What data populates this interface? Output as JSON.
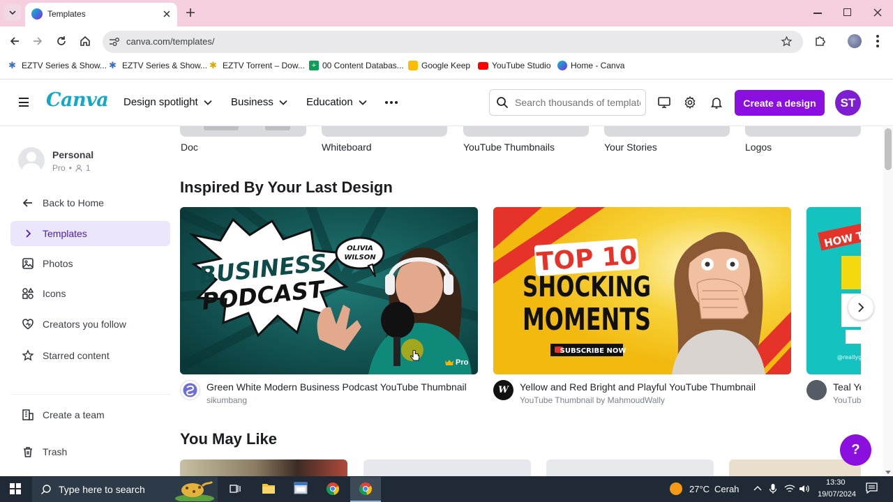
{
  "browser": {
    "tab_title": "Templates",
    "url": "canva.com/templates/",
    "bookmarks": [
      {
        "label": "EZTV Series & Show...",
        "icon": "eztv-icon"
      },
      {
        "label": "EZTV Series & Show...",
        "icon": "eztv-icon"
      },
      {
        "label": "EZTV Torrent – Dow...",
        "icon": "eztv-icon"
      },
      {
        "label": "00 Content Databas...",
        "icon": "sheets-icon"
      },
      {
        "label": "Google Keep",
        "icon": "keep-icon"
      },
      {
        "label": "YouTube Studio",
        "icon": "youtube-icon"
      },
      {
        "label": "Home - Canva",
        "icon": "canva-icon"
      }
    ]
  },
  "header": {
    "logo": "Canva",
    "nav": [
      "Design spotlight",
      "Business",
      "Education"
    ],
    "search_placeholder": "Search thousands of templates",
    "create_label": "Create a design",
    "avatar_initials": "ST",
    "brand_color": "#8b10e0"
  },
  "sidebar": {
    "profile_name": "Personal",
    "profile_plan": "Pro",
    "profile_members": "1",
    "items": [
      {
        "label": "Back to Home",
        "icon": "arrow-left-icon"
      },
      {
        "label": "Templates",
        "icon": "chevron-right-icon",
        "active": true
      },
      {
        "label": "Photos",
        "icon": "photo-icon"
      },
      {
        "label": "Icons",
        "icon": "shapes-icon"
      },
      {
        "label": "Creators you follow",
        "icon": "heart-icon"
      },
      {
        "label": "Starred content",
        "icon": "star-icon"
      }
    ],
    "create_team": "Create a team",
    "trash": "Trash"
  },
  "main": {
    "categories": [
      "Doc",
      "Whiteboard",
      "YouTube Thumbnails",
      "Your Stories",
      "Logos"
    ],
    "section_inspired": "Inspired By Your Last Design",
    "cards": [
      {
        "title": "Green White Modern Business Podcast YouTube Thumbnail",
        "author": "sikumbang",
        "badge": "Pro",
        "art_line1": "BUSINESS",
        "art_line2": "PODCAST",
        "art_bubble1": "OLIVIA",
        "art_bubble2": "WILSON"
      },
      {
        "title": "Yellow and Red Bright and Playful YouTube Thumbnail",
        "author": "YouTube Thumbnail by MahmoudWally",
        "art_line1": "TOP 10",
        "art_line2": "SHOCKING",
        "art_line3": "MOMENTS",
        "art_button": "SUBSCRIBE NOW"
      },
      {
        "title": "Teal Ye",
        "author": "YouTub",
        "art_line1": "HOW T",
        "art_handle": "@reallyg"
      }
    ],
    "section_maylike": "You May Like",
    "help_label": "?"
  },
  "taskbar": {
    "search_placeholder": "Type here to search",
    "weather_temp": "27°C",
    "weather_desc": "Cerah",
    "time": "13:30",
    "date": "19/07/2024"
  }
}
